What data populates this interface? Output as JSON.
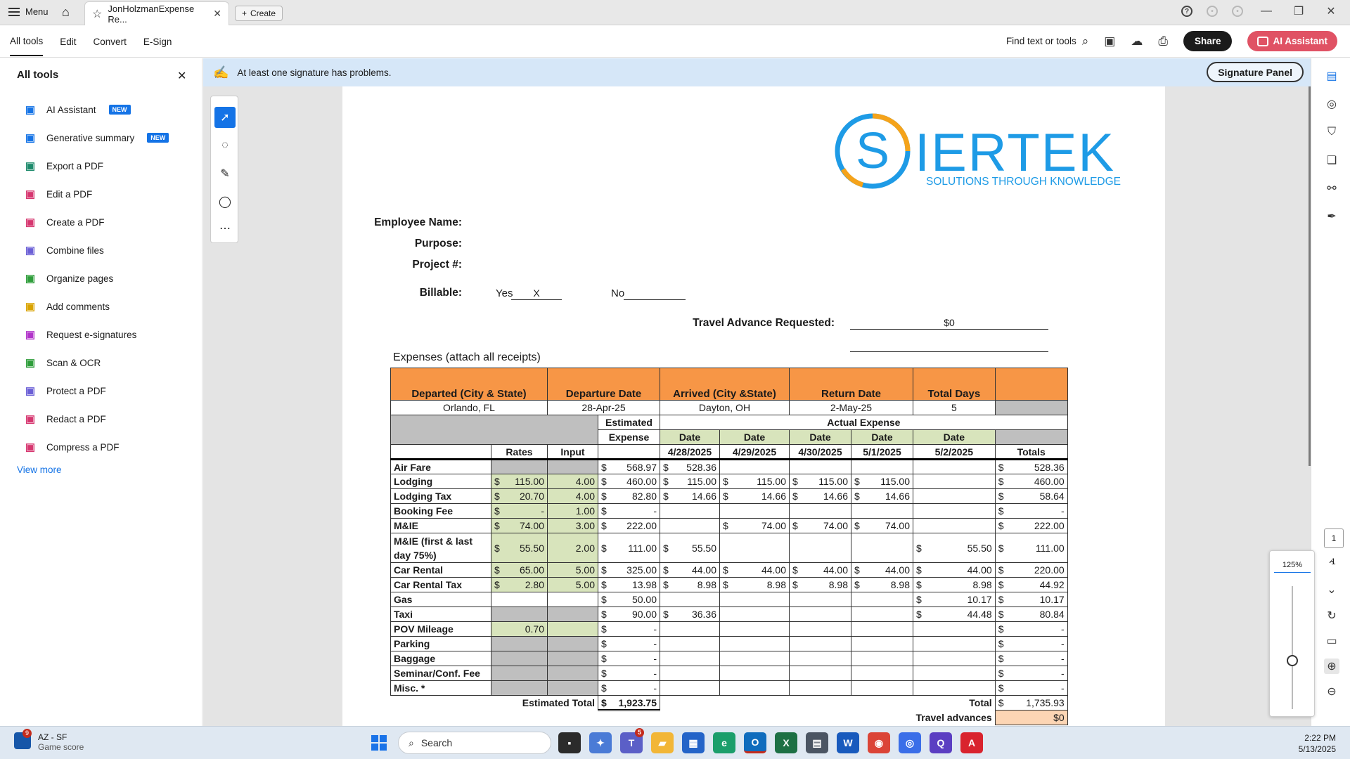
{
  "titlebar": {
    "menu_label": "Menu",
    "tab_title": "JonHolzmanExpense Re...",
    "create_label": "Create"
  },
  "toolbar": {
    "tabs": [
      "All tools",
      "Edit",
      "Convert",
      "E-Sign"
    ],
    "find_label": "Find text or tools",
    "share_label": "Share",
    "ai_label": "AI Assistant"
  },
  "left_panel": {
    "title": "All tools",
    "items": [
      {
        "label": "AI Assistant",
        "badge": "NEW",
        "icon": "ai-assistant-icon",
        "color": "#1473e6"
      },
      {
        "label": "Generative summary",
        "badge": "NEW",
        "icon": "summary-icon",
        "color": "#1473e6"
      },
      {
        "label": "Export a PDF",
        "badge": "",
        "icon": "export-pdf-icon",
        "color": "#1d8a6b"
      },
      {
        "label": "Edit a PDF",
        "badge": "",
        "icon": "edit-pdf-icon",
        "color": "#d6366f"
      },
      {
        "label": "Create a PDF",
        "badge": "",
        "icon": "create-pdf-icon",
        "color": "#d6366f"
      },
      {
        "label": "Combine files",
        "badge": "",
        "icon": "combine-files-icon",
        "color": "#6b5fd6"
      },
      {
        "label": "Organize pages",
        "badge": "",
        "icon": "organize-pages-icon",
        "color": "#2e9d3a"
      },
      {
        "label": "Add comments",
        "badge": "",
        "icon": "add-comments-icon",
        "color": "#d9a300"
      },
      {
        "label": "Request e-signatures",
        "badge": "",
        "icon": "e-signature-icon",
        "color": "#b133c9"
      },
      {
        "label": "Scan & OCR",
        "badge": "",
        "icon": "scan-ocr-icon",
        "color": "#2e9d3a"
      },
      {
        "label": "Protect a PDF",
        "badge": "",
        "icon": "protect-pdf-icon",
        "color": "#6b5fd6"
      },
      {
        "label": "Redact a PDF",
        "badge": "",
        "icon": "redact-pdf-icon",
        "color": "#d6366f"
      },
      {
        "label": "Compress a PDF",
        "badge": "",
        "icon": "compress-pdf-icon",
        "color": "#d6366f"
      }
    ],
    "view_more": "View more"
  },
  "signature_bar": {
    "message": "At least one signature has problems.",
    "button": "Signature Panel"
  },
  "doc": {
    "logo": {
      "text": "IERTEK",
      "letter": "S",
      "tagline": "SOLUTIONS THROUGH KNOWLEDGE",
      "blue": "#1e9be6",
      "orange": "#f5a31a"
    },
    "employee_label": "Employee Name:",
    "purpose_label": "Purpose:",
    "project_label": "Project #:",
    "billable_label": "Billable:",
    "yes_label": "Yes",
    "yes_value": "X",
    "no_label": "No",
    "advance_label": "Travel Advance Requested:",
    "advance_value": "$0",
    "expenses_heading": "Expenses  (attach all receipts)",
    "trip_headers": [
      "Departed (City & State)",
      "Departure Date",
      "Arrived (City &State)",
      "Return Date",
      "Total Days"
    ],
    "trip_values": [
      "Orlando, FL",
      "28-Apr-25",
      "Dayton, OH",
      "2-May-25",
      "5"
    ],
    "estimated_label": "Estimated",
    "expense_label": "Expense",
    "actual_label": "Actual Expense",
    "date_label": "Date",
    "rates_label": "Rates",
    "input_label": "Input",
    "totals_label": "Totals",
    "dates": [
      "4/28/2025",
      "4/29/2025",
      "4/30/2025",
      "5/1/2025",
      "5/2/2025"
    ],
    "rows": [
      {
        "name": "Air Fare",
        "rate": "",
        "input": "",
        "est": "568.97",
        "d": [
          "528.36",
          "",
          "",
          "",
          ""
        ],
        "total": "528.36",
        "shade": "grey"
      },
      {
        "name": "Lodging",
        "rate": "115.00",
        "input": "4.00",
        "est": "460.00",
        "d": [
          "115.00",
          "115.00",
          "115.00",
          "115.00",
          ""
        ],
        "total": "460.00",
        "shade": "green"
      },
      {
        "name": "Lodging Tax",
        "rate": "20.70",
        "input": "4.00",
        "est": "82.80",
        "d": [
          "14.66",
          "14.66",
          "14.66",
          "14.66",
          ""
        ],
        "total": "58.64",
        "shade": "green"
      },
      {
        "name": "Booking Fee",
        "rate": "-",
        "input": "1.00",
        "est": "-",
        "d": [
          "",
          "",
          "",
          "",
          ""
        ],
        "total": "-",
        "shade": "green"
      },
      {
        "name": "M&IE",
        "rate": "74.00",
        "input": "3.00",
        "est": "222.00",
        "d": [
          "",
          "74.00",
          "74.00",
          "74.00",
          ""
        ],
        "total": "222.00",
        "shade": "green"
      },
      {
        "name": "M&IE (first & last",
        "name2": "day 75%)",
        "rate": "55.50",
        "input": "2.00",
        "est": "111.00",
        "d": [
          "55.50",
          "",
          "",
          "",
          "55.50"
        ],
        "total": "111.00",
        "shade": "green"
      },
      {
        "name": "Car Rental",
        "rate": "65.00",
        "input": "5.00",
        "est": "325.00",
        "d": [
          "44.00",
          "44.00",
          "44.00",
          "44.00",
          "44.00"
        ],
        "total": "220.00",
        "shade": "green"
      },
      {
        "name": "Car Rental Tax",
        "rate": "2.80",
        "input": "5.00",
        "est": "13.98",
        "d": [
          "8.98",
          "8.98",
          "8.98",
          "8.98",
          "8.98"
        ],
        "total": "44.92",
        "shade": "green"
      },
      {
        "name": "Gas",
        "rate": "",
        "input": "",
        "est": "50.00",
        "d": [
          "",
          "",
          "",
          "",
          "10.17"
        ],
        "total": "10.17",
        "shade": "none"
      },
      {
        "name": "Taxi",
        "rate": "",
        "input": "",
        "est": "90.00",
        "d": [
          "36.36",
          "",
          "",
          "",
          "44.48"
        ],
        "total": "80.84",
        "shade": "grey"
      },
      {
        "name": "POV Mileage",
        "rate": "0.70",
        "input": "",
        "est": "-",
        "d": [
          "",
          "",
          "",
          "",
          ""
        ],
        "total": "-",
        "shade": "green"
      },
      {
        "name": "Parking",
        "rate": "",
        "input": "",
        "est": "-",
        "d": [
          "",
          "",
          "",
          "",
          ""
        ],
        "total": "-",
        "shade": "grey"
      },
      {
        "name": "Baggage",
        "rate": "",
        "input": "",
        "est": "-",
        "d": [
          "",
          "",
          "",
          "",
          ""
        ],
        "total": "-",
        "shade": "grey"
      },
      {
        "name": "Seminar/Conf. Fee",
        "rate": "",
        "input": "",
        "est": "-",
        "d": [
          "",
          "",
          "",
          "",
          ""
        ],
        "total": "-",
        "shade": "grey"
      },
      {
        "name": "Misc. *",
        "rate": "",
        "input": "",
        "est": "-",
        "d": [
          "",
          "",
          "",
          "",
          ""
        ],
        "total": "-",
        "shade": "grey"
      }
    ],
    "est_total_label": "Estimated Total",
    "est_total": "1,923.75",
    "total_label": "Total",
    "total": "1,735.93",
    "advances_label": "Travel advances",
    "advances_value": "$0"
  },
  "zoom": {
    "level": "125%",
    "page_current": "1",
    "page_total": "1"
  },
  "taskbar": {
    "game_title": "AZ - SF",
    "game_sub": "Game score",
    "game_badge": "9",
    "search": "Search",
    "teams_badge": "5",
    "time": "2:22 PM",
    "date": "5/13/2025"
  }
}
